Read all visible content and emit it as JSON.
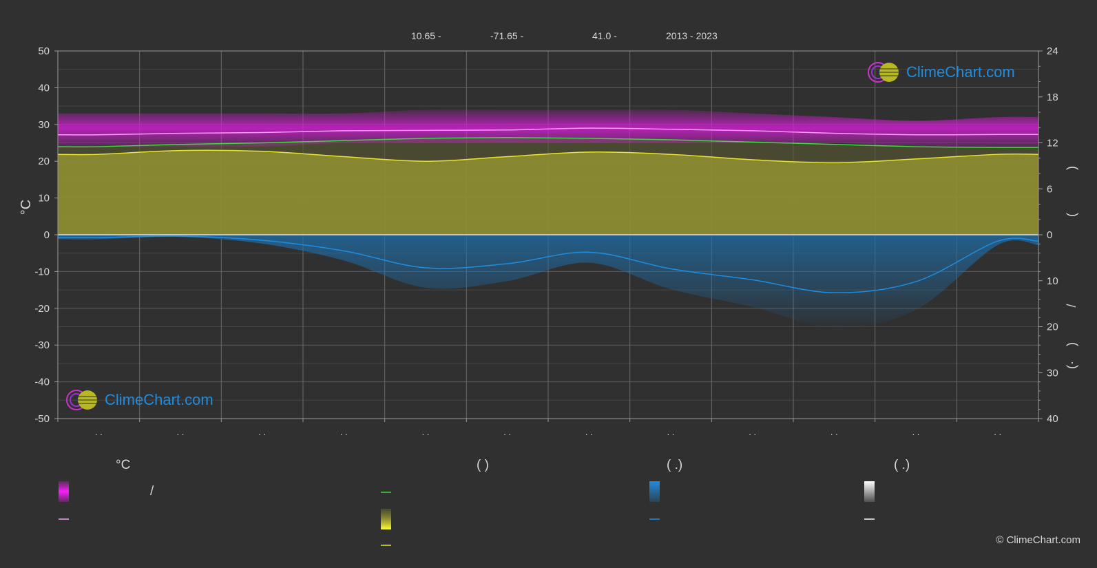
{
  "header": {
    "lat": "10.65 -",
    "lon": "-71.65 -",
    "elev": "41.0 -",
    "years": "2013 - 2023"
  },
  "logo": {
    "text": "ClimeChart.com"
  },
  "copyright": "© ClimeChart.com",
  "legend": {
    "col1_title": "°C",
    "col2_title": "(            )",
    "col3_title": "(    .)",
    "col4_title": "(    .)",
    "slash": "/"
  },
  "colors": {
    "background": "#303030",
    "temp_band": "#d21ed2",
    "temp_line": "#ff9cff",
    "daylight_line": "#3cdc3c",
    "sunshine_fill": "#8c8c32",
    "sunshine_line": "#e6e632",
    "precip": "#1e8de0",
    "grid": "#5a5a5a"
  },
  "chart_data": {
    "type": "area",
    "title": "",
    "x": [
      1,
      2,
      3,
      4,
      5,
      6,
      7,
      8,
      9,
      10,
      11,
      12
    ],
    "x_tick_labels": [
      ". .",
      ". .",
      ". .",
      ". .",
      ". .",
      ". .",
      ". .",
      ". .",
      ". .",
      ". .",
      ". .",
      ". ."
    ],
    "ylabel_left": "°C",
    "ylim_left": [
      -50,
      50
    ],
    "yticks_left": [
      50,
      40,
      30,
      20,
      10,
      0,
      -10,
      -20,
      -30,
      -40,
      -50
    ],
    "yticks_right_top": [
      24,
      18,
      12,
      6,
      0
    ],
    "yticks_right_bottom": [
      10,
      20,
      30,
      40
    ],
    "right_axis_labels": [
      ")",
      "(",
      "/",
      ")",
      "·",
      "("
    ],
    "grid": true,
    "series": [
      {
        "key": "temp_max_band",
        "values": [
          33,
          33,
          33,
          33,
          34,
          34,
          34,
          34,
          33,
          32,
          31,
          32
        ]
      },
      {
        "key": "temp_min_band",
        "values": [
          24,
          24,
          24,
          25,
          25,
          25,
          25,
          25,
          25,
          25,
          24,
          24
        ]
      },
      {
        "key": "temp_mean",
        "values": [
          27.2,
          27.6,
          27.8,
          28.3,
          28.4,
          28.5,
          29.0,
          28.7,
          28.3,
          27.6,
          27.2,
          27.3
        ]
      },
      {
        "key": "daylight_hours",
        "values": [
          11.5,
          11.8,
          12.0,
          12.3,
          12.6,
          12.7,
          12.6,
          12.4,
          12.1,
          11.8,
          11.5,
          11.4
        ]
      },
      {
        "key": "sunshine_hours",
        "values": [
          10.5,
          11.0,
          10.9,
          10.2,
          9.6,
          10.2,
          10.8,
          10.5,
          9.8,
          9.4,
          9.9,
          10.5
        ]
      },
      {
        "key": "precip_mm_day",
        "values": [
          0.6,
          0.3,
          1.2,
          3.5,
          7.2,
          6.3,
          3.8,
          7.4,
          9.8,
          12.6,
          10.2,
          1.4
        ]
      }
    ]
  }
}
